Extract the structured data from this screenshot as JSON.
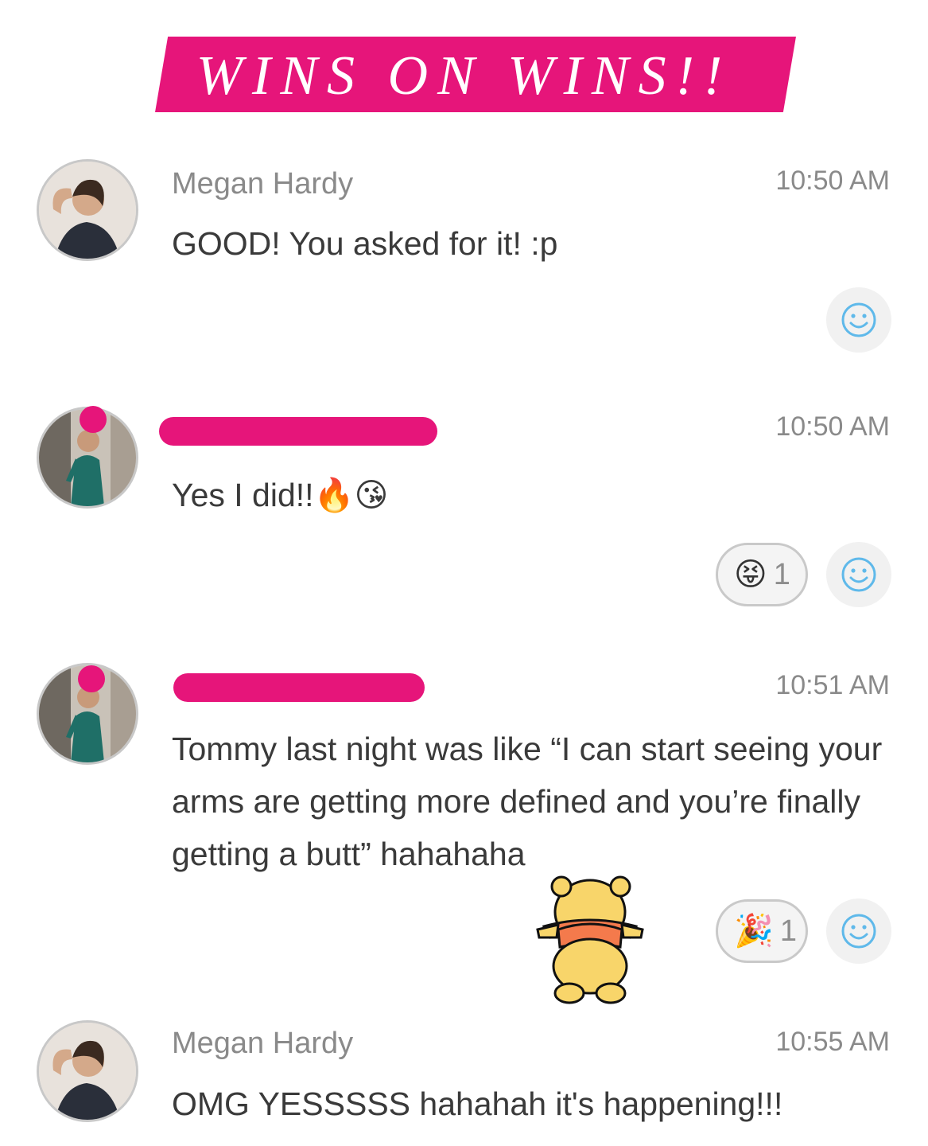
{
  "banner": {
    "title": "WINS ON WINS!!",
    "color": "#e6157a"
  },
  "messages": [
    {
      "sender": "Megan Hardy",
      "time": "10:50 AM",
      "text": "GOOD! You asked for it! :p",
      "avatar": "avatar-photo"
    },
    {
      "sender": "",
      "sender_redacted": true,
      "time": "10:50 AM",
      "text": "Yes I did!!🔥😘",
      "avatar": "avatar-photo",
      "reaction": {
        "emoji": "😝",
        "count": "1"
      }
    },
    {
      "sender": "",
      "sender_redacted": true,
      "time": "10:51 AM",
      "text": "Tommy last night was like “I can start seeing your arms are getting more defined and you’re finally getting a butt” hahahaha",
      "avatar": "avatar-photo",
      "reaction": {
        "emoji": "🎉",
        "count": "1"
      },
      "sticker": "winnie-the-pooh-sticker"
    },
    {
      "sender": "Megan Hardy",
      "time": "10:55 AM",
      "text": "OMG YESSSSS hahahah it's happening!!!",
      "avatar": "avatar-photo"
    }
  ],
  "icons": {
    "add_reaction": "smiley-icon"
  },
  "colors": {
    "accent": "#e6157a",
    "emoji_icon": "#5fb9ea",
    "muted_text": "#8a8a8a"
  }
}
